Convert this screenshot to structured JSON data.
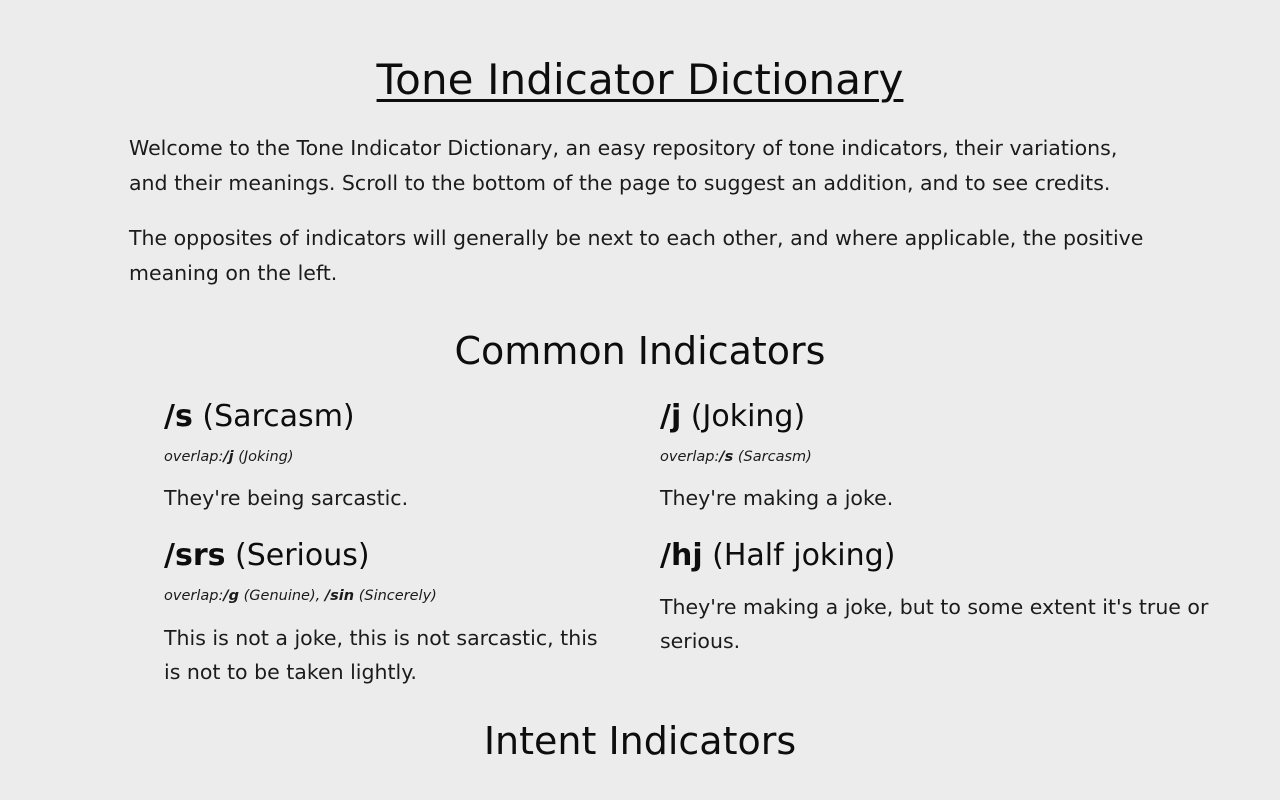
{
  "title": {
    "text": "Tone Indicator Dictionary",
    "underlined": true
  },
  "intro": {
    "paragraph1": "Welcome to the Tone Indicator Dictionary, an easy repository of tone indicators, their variations, and their meanings. Scroll to the bottom of the page to suggest an addition, and to see credits.",
    "paragraph2": "The opposites of indicators will generally be next to each other, and where applicable, the positive meaning on the left."
  },
  "sections": [
    {
      "heading": "Common Indicators",
      "entries": [
        {
          "tag": "/s",
          "gloss": "(Sarcasm)",
          "overlap_label": "overlap:",
          "overlap_tag": "/j",
          "overlap_gloss": "(Joking)",
          "definition": "They're being sarcastic."
        },
        {
          "tag": "/j",
          "gloss": "(Joking)",
          "overlap_label": "overlap:",
          "overlap_tag": "/s",
          "overlap_gloss": "(Sarcasm)",
          "definition": "They're making a joke."
        },
        {
          "tag": "/srs",
          "gloss": "(Serious)",
          "overlap_label": "overlap:",
          "overlap_tag": "/g",
          "overlap_gloss": "(Genuine),",
          "overlap_tag2": "/sin",
          "overlap_gloss2": "(Sincerely)",
          "definition": "This is not a joke, this is not sarcastic, this is not to be taken lightly."
        },
        {
          "tag": "/hj",
          "gloss": "(Half joking)",
          "definition": "They're making a joke, but to some extent it's true or serious."
        }
      ]
    },
    {
      "heading": "Intent Indicators"
    }
  ],
  "colors": {
    "background": "#ececec",
    "text": "#1b1b1b",
    "heading": "#0d0d0d"
  }
}
